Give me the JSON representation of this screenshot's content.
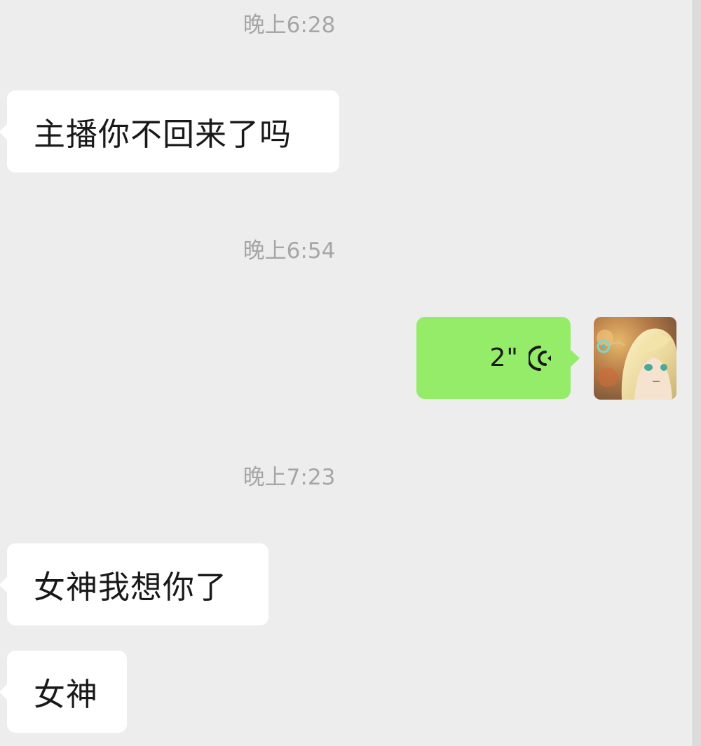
{
  "messages": [
    {
      "type": "timestamp",
      "text": "晚上6:28"
    },
    {
      "type": "incoming",
      "text": "主播你不回来了吗"
    },
    {
      "type": "timestamp",
      "text": "晚上6:54"
    },
    {
      "type": "outgoing_voice",
      "duration": "2\"",
      "icon": "voice-wave-icon"
    },
    {
      "type": "timestamp",
      "text": "晚上7:23"
    },
    {
      "type": "incoming",
      "text": "女神我想你了"
    },
    {
      "type": "incoming",
      "text": "女神"
    }
  ],
  "colors": {
    "background": "#ededed",
    "incoming_bubble": "#ffffff",
    "outgoing_bubble": "#95ec69",
    "timestamp": "#a6a6a6",
    "text": "#191919"
  }
}
